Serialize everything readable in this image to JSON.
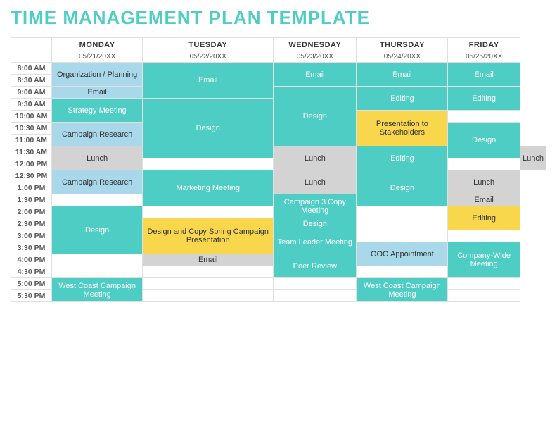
{
  "title": "TIME MANAGEMENT PLAN TEMPLATE",
  "days": [
    "MONDAY",
    "TUESDAY",
    "WEDNESDAY",
    "THURSDAY",
    "FRIDAY"
  ],
  "dates": [
    "05/21/20XX",
    "05/22/20XX",
    "05/23/20XX",
    "05/24/20XX",
    "05/25/20XX"
  ],
  "times": [
    "8:00 AM",
    "8:30 AM",
    "9:00 AM",
    "9:30 AM",
    "10:00 AM",
    "10:30 AM",
    "11:00 AM",
    "11:30 AM",
    "12:00 PM",
    "12:30 PM",
    "1:00 PM",
    "1:30 PM",
    "2:00 PM",
    "2:30 PM",
    "3:00 PM",
    "3:30 PM",
    "4:00 PM",
    "4:30 PM",
    "5:00 PM",
    "5:30 PM"
  ]
}
